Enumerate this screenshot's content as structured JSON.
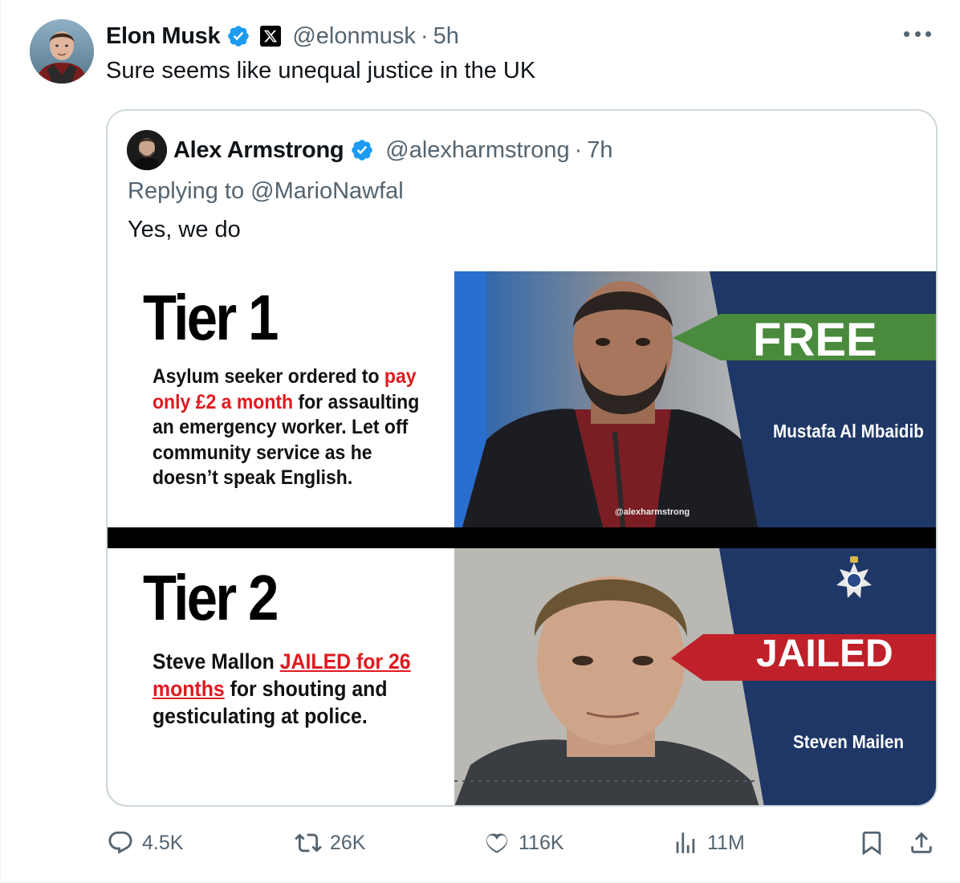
{
  "post": {
    "author_name": "Elon Musk",
    "handle": "@elonmusk",
    "separator": "·",
    "time": "5h",
    "text": "Sure seems like unequal justice in the UK"
  },
  "quoted": {
    "author_name": "Alex Armstrong",
    "handle": "@alexharmstrong",
    "separator": "·",
    "time": "7h",
    "reply_prefix": "Replying to ",
    "reply_to": "@MarioNawfal",
    "text": "Yes, we do",
    "image": {
      "tier1": {
        "title": "Tier 1",
        "body_a": "Asylum seeker ordered to ",
        "body_red": "pay only £2 a month",
        "body_b": " for assaulting an emergency worker. Let off community service as he doesn’t speak English.",
        "label": "FREE",
        "name": "Mustafa Al Mbaidib",
        "watermark": "@alexharmstrong",
        "label_color": "#4a8a3c"
      },
      "tier2": {
        "title": "Tier 2",
        "body_a": "Steve Mallon ",
        "body_red": "JAILED for 26 months",
        "body_b": " for shouting and gesticulating at police.",
        "label": "JAILED",
        "name": "Steven Mailen",
        "label_color": "#c0202a"
      }
    }
  },
  "actions": {
    "replies": "4.5K",
    "reposts": "26K",
    "likes": "116K",
    "views": "11M"
  },
  "colors": {
    "verified": "#1d9bf0",
    "secondary_text": "#536471",
    "border": "#cfd9de",
    "panel_blue": "#1e3766"
  }
}
